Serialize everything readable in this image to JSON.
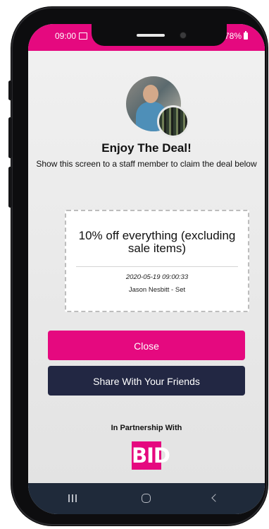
{
  "status_bar": {
    "time": "09:00",
    "battery": "78%",
    "color": "#e5097f"
  },
  "deal": {
    "title": "Enjoy The Deal!",
    "instructions": "Show this screen to a staff member to claim the deal below",
    "offer": "10% off everything (excluding sale items)",
    "timestamp": "2020-05-19 09:00:33",
    "claimant": "Jason Nesbitt - Set"
  },
  "actions": {
    "close_label": "Close",
    "share_label": "Share With Your Friends"
  },
  "partner": {
    "heading": "In Partnership With",
    "logo_text": "BID",
    "logo_color": "#e5097f"
  },
  "nav": {
    "recents_icon": "recents-icon",
    "home_icon": "home-icon",
    "back_icon": "back-icon",
    "bar_color": "#1f2a3a"
  }
}
